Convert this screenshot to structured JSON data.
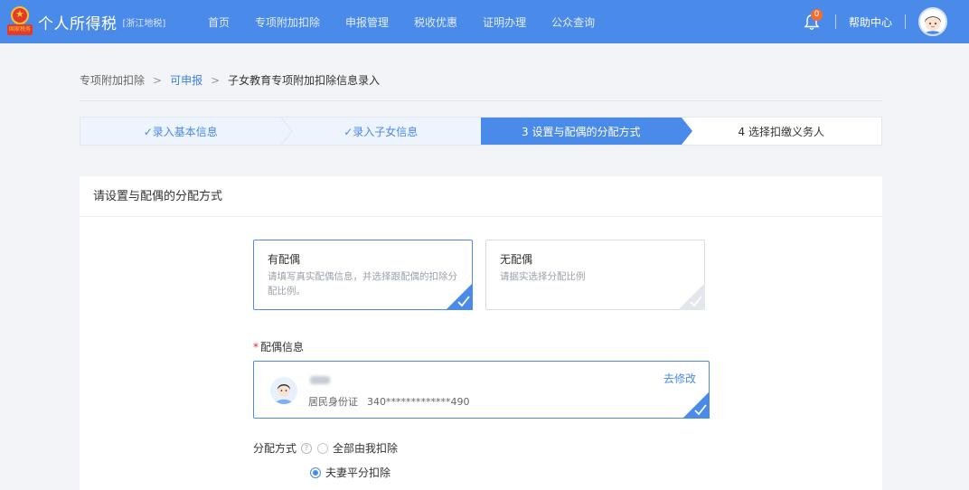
{
  "header": {
    "title": "个人所得税",
    "region": "[浙江地税]",
    "emblem_text": "国家税务",
    "nav": [
      "首页",
      "专项附加扣除",
      "申报管理",
      "税收优惠",
      "证明办理",
      "公众查询"
    ],
    "notification_count": "0",
    "help_label": "帮助中心"
  },
  "breadcrumb": {
    "items": [
      "专项附加扣除",
      "可申报"
    ],
    "separator": ">",
    "current": "子女教育专项附加扣除信息录入"
  },
  "steps": [
    {
      "label": "✓录入基本信息",
      "state": "done"
    },
    {
      "label": "✓录入子女信息",
      "state": "done"
    },
    {
      "label": "3 设置与配偶的分配方式",
      "state": "active"
    },
    {
      "label": "4 选择扣缴义务人",
      "state": "todo"
    }
  ],
  "card": {
    "title": "请设置与配偶的分配方式",
    "options": [
      {
        "title": "有配偶",
        "desc": "请填写真实配偶信息，并选择跟配偶的扣除分配比例。",
        "selected": true
      },
      {
        "title": "无配偶",
        "desc": "请据实选择分配比例",
        "selected": false
      }
    ],
    "spouse_label": "配偶信息",
    "required_mark": "*",
    "spouse": {
      "id_type": "居民身份证",
      "id_number": "340*************490",
      "edit_label": "去修改"
    },
    "method_label": "分配方式",
    "methods": [
      {
        "label": "全部由我扣除",
        "checked": false
      },
      {
        "label": "夫妻平分扣除",
        "checked": true
      }
    ]
  },
  "colors": {
    "primary": "#4a8ae9",
    "badge": "#f56c2b"
  }
}
